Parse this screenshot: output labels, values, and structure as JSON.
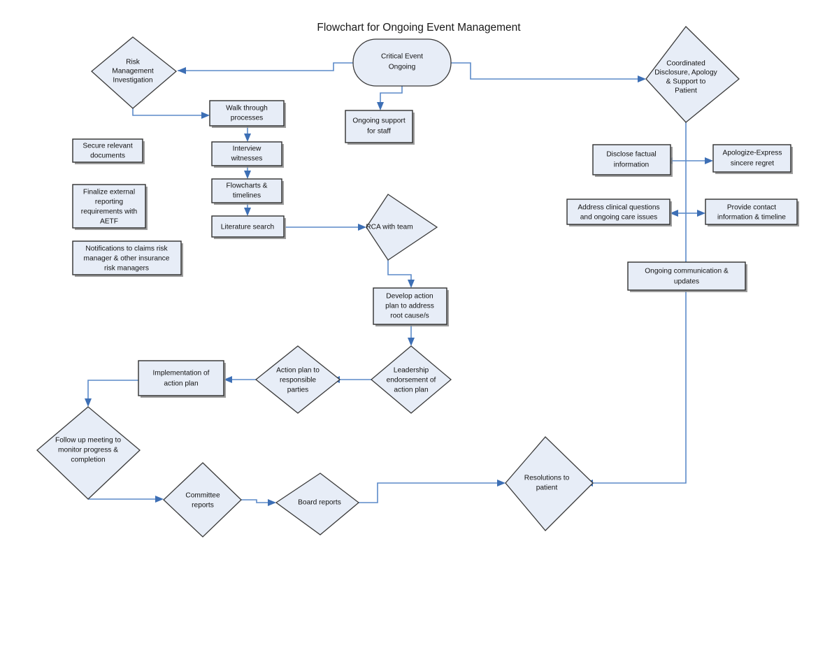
{
  "title": "Flowchart for Ongoing Event Management",
  "colors": {
    "node_fill": "#E7EDF7",
    "node_stroke": "#3a3a3a",
    "edge": "#5C8AC9",
    "arrow": "#3D6FB5",
    "background": "#FFFFFF",
    "text": "#111111"
  },
  "nodes": {
    "critical_event": {
      "label": "Critical Event Ongoing",
      "lines": [
        "Critical Event",
        "Ongoing"
      ],
      "shape": "terminator"
    },
    "risk_mgmt": {
      "label": "Risk Management Investigation",
      "lines": [
        "Risk",
        "Management",
        "Investigation"
      ],
      "shape": "diamond"
    },
    "ongoing_support": {
      "label": "Ongoing support for staff",
      "lines": [
        "Ongoing support",
        "for staff"
      ],
      "shape": "process"
    },
    "coordinated_disclosure": {
      "label": "Coordinated Disclosure, Apology & Support to Patient",
      "lines": [
        "Coordinated",
        "Disclosure, Apology",
        "& Support to",
        "Patient"
      ],
      "shape": "diamond"
    },
    "walk_through": {
      "label": "Walk through processes",
      "lines": [
        "Walk through",
        "processes"
      ],
      "shape": "process"
    },
    "interview_witnesses": {
      "label": "Interview witnesses",
      "lines": [
        "Interview",
        "witnesses"
      ],
      "shape": "process"
    },
    "flowcharts_timelines": {
      "label": "Flowcharts & timelines",
      "lines": [
        "Flowcharts &",
        "timelines"
      ],
      "shape": "process"
    },
    "literature_search": {
      "label": "Literature search",
      "lines": [
        "Literature search"
      ],
      "shape": "process"
    },
    "secure_documents": {
      "label": "Secure relevant documents",
      "lines": [
        "Secure relevant",
        "documents"
      ],
      "shape": "process"
    },
    "finalize_reporting": {
      "label": "Finalize external reporting requirements with AETF",
      "lines": [
        "Finalize external",
        "reporting",
        "requirements with",
        "AETF"
      ],
      "shape": "process"
    },
    "notifications_claims": {
      "label": "Notifications to claims risk manager & other insurance risk managers",
      "lines": [
        "Notifications to claims risk",
        "manager & other insurance",
        "risk managers"
      ],
      "shape": "process"
    },
    "rca_with_team": {
      "label": "RCA with team",
      "lines": [
        "RCA with team"
      ],
      "shape": "diamond"
    },
    "develop_action_plan": {
      "label": "Develop action plan to address root cause/s",
      "lines": [
        "Develop action",
        "plan to address",
        "root cause/s"
      ],
      "shape": "process"
    },
    "leadership_endorsement": {
      "label": "Leadership endorsement of action plan",
      "lines": [
        "Leadership",
        "endorsement of",
        "action plan"
      ],
      "shape": "diamond"
    },
    "action_plan_parties": {
      "label": "Action plan to responsible parties",
      "lines": [
        "Action plan to",
        "responsible",
        "parties"
      ],
      "shape": "diamond"
    },
    "implementation": {
      "label": "Implementation of action plan",
      "lines": [
        "Implementation of",
        "action plan"
      ],
      "shape": "process"
    },
    "follow_up_meeting": {
      "label": "Follow up meeting to monitor progress & completion",
      "lines": [
        "Follow up meeting to",
        "monitor progress &",
        "completion"
      ],
      "shape": "diamond"
    },
    "committee_reports": {
      "label": "Committee reports",
      "lines": [
        "Committee",
        "reports"
      ],
      "shape": "diamond"
    },
    "board_reports": {
      "label": "Board reports",
      "lines": [
        "Board reports"
      ],
      "shape": "diamond"
    },
    "resolutions_patient": {
      "label": "Resolutions to patient",
      "lines": [
        "Resolutions to",
        "patient"
      ],
      "shape": "diamond"
    },
    "disclose_factual": {
      "label": "Disclose factual information",
      "lines": [
        "Disclose factual",
        "information"
      ],
      "shape": "process"
    },
    "apologize_regret": {
      "label": "Apologize-Express sincere regret",
      "lines": [
        "Apologize-Express",
        "sincere regret"
      ],
      "shape": "process"
    },
    "address_clinical": {
      "label": "Address clinical questions and ongoing care issues",
      "lines": [
        "Address clinical questions",
        "and ongoing care issues"
      ],
      "shape": "process"
    },
    "provide_contact": {
      "label": "Provide contact information & timeline",
      "lines": [
        "Provide contact",
        "information & timeline"
      ],
      "shape": "process"
    },
    "ongoing_communication": {
      "label": "Ongoing communication & updates",
      "lines": [
        "Ongoing communication &",
        "updates"
      ],
      "shape": "process"
    }
  },
  "edges": [
    {
      "from": "critical_event",
      "to": "risk_mgmt"
    },
    {
      "from": "critical_event",
      "to": "coordinated_disclosure"
    },
    {
      "from": "critical_event",
      "to": "ongoing_support"
    },
    {
      "from": "risk_mgmt",
      "to": "walk_through"
    },
    {
      "from": "walk_through",
      "to": "interview_witnesses"
    },
    {
      "from": "interview_witnesses",
      "to": "flowcharts_timelines"
    },
    {
      "from": "flowcharts_timelines",
      "to": "literature_search"
    },
    {
      "from": "literature_search",
      "to": "rca_with_team"
    },
    {
      "from": "rca_with_team",
      "to": "develop_action_plan"
    },
    {
      "from": "develop_action_plan",
      "to": "leadership_endorsement"
    },
    {
      "from": "leadership_endorsement",
      "to": "action_plan_parties"
    },
    {
      "from": "action_plan_parties",
      "to": "implementation"
    },
    {
      "from": "implementation",
      "to": "follow_up_meeting"
    },
    {
      "from": "follow_up_meeting",
      "to": "committee_reports"
    },
    {
      "from": "committee_reports",
      "to": "board_reports"
    },
    {
      "from": "board_reports",
      "to": "resolutions_patient"
    },
    {
      "from": "coordinated_disclosure",
      "to": "disclose_factual"
    },
    {
      "from": "coordinated_disclosure",
      "to": "apologize_regret"
    },
    {
      "from": "coordinated_disclosure",
      "to": "address_clinical"
    },
    {
      "from": "coordinated_disclosure",
      "to": "provide_contact"
    },
    {
      "from": "coordinated_disclosure",
      "to": "ongoing_communication"
    },
    {
      "from": "ongoing_communication",
      "to": "resolutions_patient"
    }
  ]
}
